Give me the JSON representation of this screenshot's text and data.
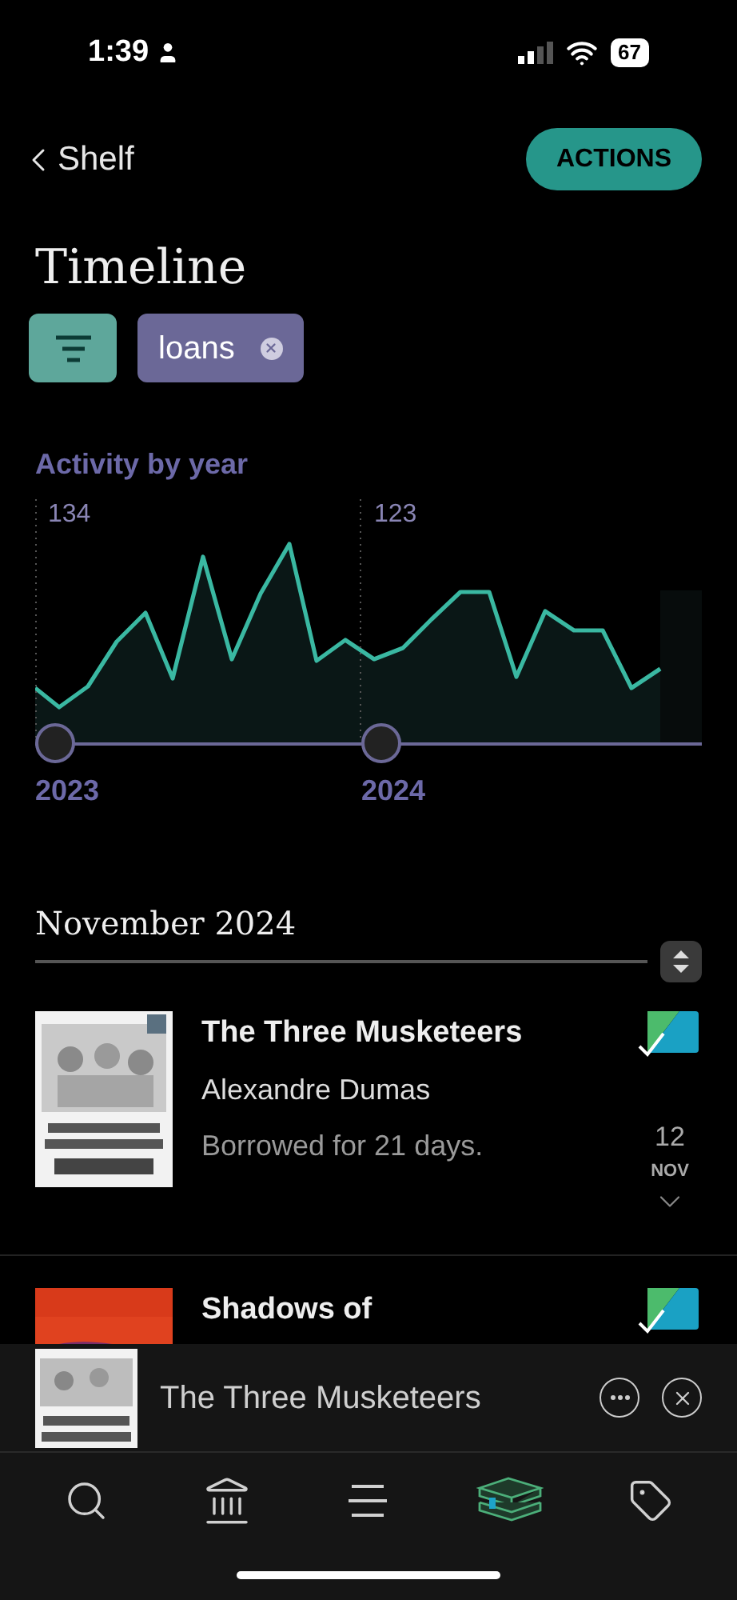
{
  "status_bar": {
    "time": "1:39",
    "battery": "67"
  },
  "nav": {
    "back": "Shelf",
    "action": "ACTIONS"
  },
  "title": "Timeline",
  "filters": [
    {
      "label": "loans"
    }
  ],
  "activity": {
    "title": "Activity by year",
    "years": [
      {
        "year": "2023",
        "count": "134"
      },
      {
        "year": "2024",
        "count": "123"
      }
    ]
  },
  "section": {
    "title": "November 2024"
  },
  "loans": [
    {
      "title": "The Three Musketeers",
      "author": "Alexandre Dumas",
      "note": "Borrowed for 21 days.",
      "day": "12",
      "month": "NOV",
      "finished": true
    },
    {
      "title": "Shadows of",
      "finished": true
    }
  ],
  "mini_player": {
    "title": "The Three Musketeers"
  },
  "tab_bar": [
    {
      "selected": false
    },
    {
      "selected": false
    },
    {
      "selected": false
    },
    {
      "selected": true
    },
    {
      "selected": false
    }
  ]
}
